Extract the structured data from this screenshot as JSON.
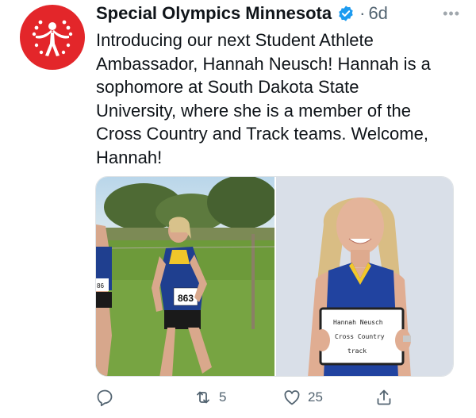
{
  "tweet": {
    "author_name": "Special Olympics Minnesota",
    "time_separator": "·",
    "time": "6d",
    "more_label": "•••",
    "text": "Introducing our next Student Athlete\nAmbassador, Hannah Neusch! Hannah is a\nsophomore at South Dakota State\nUniversity, where she is a member of the\nCross Country and Track teams. Welcome,\nHannah!"
  },
  "media": {
    "left_photo": {
      "bib_number": "863",
      "side_bib": "86"
    },
    "right_photo": {
      "sign_lines": [
        "Hannah Neusch",
        "Cross Country",
        "track"
      ]
    }
  },
  "actions": {
    "reply_count": "",
    "retweet_count": "5",
    "like_count": "25"
  },
  "colors": {
    "brand_red": "#e3262a",
    "verified_blue": "#1d9bf0",
    "text_primary": "#0f1419",
    "text_secondary": "#536471"
  },
  "icons": [
    "special-olympics-logo-icon",
    "verified-badge-icon",
    "more-options-icon",
    "reply-icon",
    "retweet-icon",
    "like-icon",
    "share-icon"
  ]
}
